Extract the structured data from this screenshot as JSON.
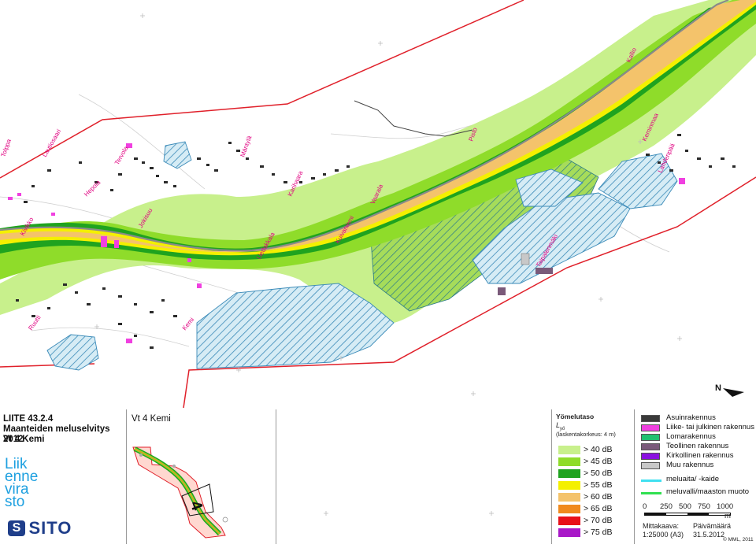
{
  "title": {
    "line1": "LIITE 43.2.4",
    "line2": "Maanteiden meluselvitys 2012",
    "line3": "Vt 4 Kemi"
  },
  "logos": {
    "agency": "Liikennevirasto",
    "agency_lines": [
      "Liik",
      "enne",
      "vira",
      "sto"
    ],
    "consultant": "SITO"
  },
  "key_map": {
    "title": "Vt 4 Kemi",
    "sheet_number": "4"
  },
  "noise_legend": {
    "title": "Yömelutaso",
    "symbol": "L",
    "symbol_sub": "yö",
    "height_note": "(laskentakorkeus: 4 m)",
    "classes": [
      {
        "label": "> 40 dB",
        "color": "#c8f08c"
      },
      {
        "label": "> 45 dB",
        "color": "#8fdc2a"
      },
      {
        "label": "> 50 dB",
        "color": "#1fa31f"
      },
      {
        "label": "> 55 dB",
        "color": "#f4f000"
      },
      {
        "label": "> 60 dB",
        "color": "#f4c36b"
      },
      {
        "label": "> 65 dB",
        "color": "#f08a1e"
      },
      {
        "label": "> 70 dB",
        "color": "#e8101a"
      },
      {
        "label": "> 75 dB",
        "color": "#a818c8"
      }
    ]
  },
  "building_legend": [
    {
      "label": "Asuinrakennus",
      "color": "#3a3a3a"
    },
    {
      "label": "Liike- tai julkinen rakennus",
      "color": "#f040e0"
    },
    {
      "label": "Lomarakennus",
      "color": "#20c070"
    },
    {
      "label": "Teollinen rakennus",
      "color": "#7a5a7a"
    },
    {
      "label": "Kirkollinen rakennus",
      "color": "#8a10e0"
    },
    {
      "label": "Muu rakennus",
      "color": "#c8c8c8"
    }
  ],
  "barrier_legend": [
    {
      "label": "meluaita/ -kaide",
      "color": "#40e0f0"
    },
    {
      "label": "meluvalli/maaston muoto",
      "color": "#30e050"
    }
  ],
  "scale_bar": {
    "ticks": [
      "0",
      "250",
      "500",
      "750",
      "1000"
    ],
    "unit": "m"
  },
  "footer": {
    "scale_label": "Mittakaava:",
    "scale_value": "1:25000 (A3)",
    "date_label": "Päivämäärä",
    "date_value": "31.5.2012",
    "copyright": "© MML, 2011"
  },
  "north_label": "N",
  "place_names": [
    "Tolppa",
    "Kivikko",
    "Lautiosaari",
    "Hepola",
    "Tervola",
    "Ruutti",
    "Jokisuu",
    "Kemi",
    "Mäntylä",
    "Karihaara",
    "Kuivaniemi",
    "Vaarala",
    "Pisto",
    "Kallio",
    "Keminmaa",
    "Lahdenpää",
    "Taipalenmäki",
    "Liedakkala"
  ],
  "colors": {
    "boundary": "#e0202a",
    "road": "#9a9a9a",
    "hatch": "#3a8ab8",
    "hatch_bg": "#bfe0ee"
  }
}
